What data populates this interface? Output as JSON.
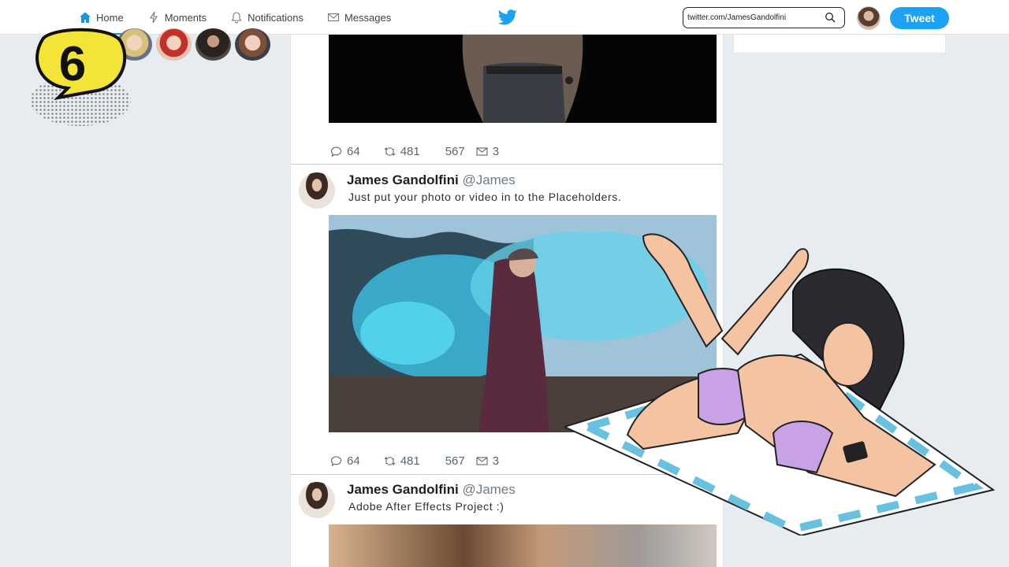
{
  "nav": {
    "items": [
      {
        "label": "Home",
        "icon": "home-icon",
        "active": true
      },
      {
        "label": "Moments",
        "icon": "lightning-icon"
      },
      {
        "label": "Notifications",
        "icon": "bell-icon"
      },
      {
        "label": "Messages",
        "icon": "envelope-icon"
      }
    ]
  },
  "search": {
    "value": "twitter.com/JamesGandolfini"
  },
  "tweet_button": "Tweet",
  "badge": {
    "number": "6"
  },
  "timeline": {
    "tweets": [
      {
        "stats": {
          "replies": "64",
          "retweets": "481",
          "likes": "567",
          "messages": "3"
        }
      },
      {
        "name": "James Gandolfini",
        "handle": "@James",
        "text": "Just put your photo or video in to the Placeholders.",
        "stats": {
          "replies": "64",
          "retweets": "481",
          "likes": "567",
          "messages": "3"
        }
      },
      {
        "name": "James Gandolfini",
        "handle": "@James",
        "text": "Adobe After Effects Project :)"
      }
    ]
  },
  "colors": {
    "accent": "#1da1f2",
    "badge_yellow": "#f3e437",
    "background": "#e6ecf0"
  }
}
